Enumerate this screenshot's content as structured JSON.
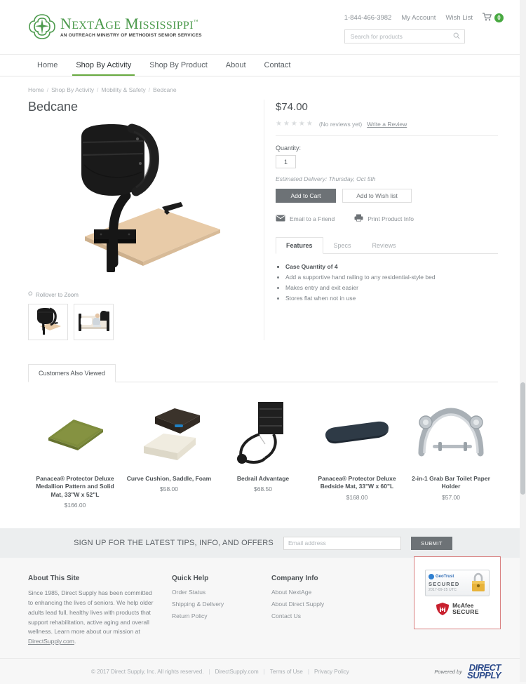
{
  "header": {
    "logo_title_parts": [
      "N",
      "EXT",
      "A",
      "GE",
      " M",
      "ISSISSIPPI"
    ],
    "logo_title": "NextAge Mississippi",
    "logo_tm": "™",
    "logo_subtitle": "AN OUTREACH MINISTRY OF METHODIST SENIOR SERVICES",
    "phone": "1-844-466-3982",
    "my_account": "My Account",
    "wish_list": "Wish List",
    "cart_count": "0",
    "search_placeholder": "Search for products",
    "search_value": "",
    "accent_green": "#4c9a4c",
    "cart_badge_green": "#49a942"
  },
  "nav": {
    "items": [
      {
        "label": "Home",
        "active": false
      },
      {
        "label": "Shop By Activity",
        "active": true
      },
      {
        "label": "Shop By Product",
        "active": false
      },
      {
        "label": "About",
        "active": false
      },
      {
        "label": "Contact",
        "active": false
      }
    ]
  },
  "breadcrumb": {
    "items": [
      "Home",
      "Shop By Activity",
      "Mobility & Safety",
      "Bedcane"
    ],
    "separator": "/"
  },
  "product": {
    "title": "Bedcane",
    "price": "$74.00",
    "stars": "★★★★★",
    "reviews_text": "(No reviews yet)",
    "write_review": "Write a Review",
    "quantity_label": "Quantity:",
    "quantity_value": "1",
    "estimated_delivery": "Estimated Delivery: Thursday, Oct 5th",
    "add_to_cart": "Add to Cart",
    "add_to_wish_list": "Add to Wish list",
    "email_friend": "Email to a Friend",
    "print_info": "Print Product Info",
    "rollover_zoom": "Rollover to Zoom",
    "tabs": [
      {
        "label": "Features",
        "active": true
      },
      {
        "label": "Specs",
        "active": false
      },
      {
        "label": "Reviews",
        "active": false
      }
    ],
    "features": [
      {
        "text": "Case Quantity of 4",
        "bold": true
      },
      {
        "text": "Add a supportive hand railing to any residential-style bed",
        "bold": false
      },
      {
        "text": "Makes entry and exit easier",
        "bold": false
      },
      {
        "text": "Stores flat when not in use",
        "bold": false
      }
    ]
  },
  "also_viewed": {
    "tab_label": "Customers Also Viewed",
    "items": [
      {
        "name": "Panacea® Protector Deluxe Medallion Pattern and Solid Mat, 33\"W x 52\"L",
        "price": "$166.00",
        "image": "olive-mat"
      },
      {
        "name": "Curve Cushion, Saddle, Foam",
        "price": "$58.00",
        "image": "cushion-stack"
      },
      {
        "name": "Bedrail Advantage",
        "price": "$68.50",
        "image": "bedrail"
      },
      {
        "name": "Panacea® Protector Deluxe Bedside Mat, 33\"W x 60\"L",
        "price": "$168.00",
        "image": "navy-mat"
      },
      {
        "name": "2-in-1 Grab Bar Toilet Paper Holder",
        "price": "$57.00",
        "image": "grab-bar"
      }
    ]
  },
  "newsletter": {
    "heading": "SIGN UP FOR THE LATEST TIPS, INFO, AND OFFERS",
    "placeholder": "Email address",
    "value": "",
    "submit_label": "SUBMIT"
  },
  "footer": {
    "about": {
      "title": "About This Site",
      "body_before": "Since 1985, Direct Supply has been committed to enhancing the lives of seniors. We help older adults lead full, healthy lives with products that support rehabilitation, active aging and overall wellness. Learn more about our mission at ",
      "link": "DirectSupply.com",
      "body_after": "."
    },
    "quick_help": {
      "title": "Quick Help",
      "links": [
        "Order Status",
        "Shipping & Delivery",
        "Return Policy"
      ]
    },
    "company_info": {
      "title": "Company Info",
      "links": [
        "About NextAge",
        "About Direct Supply",
        "Contact Us"
      ]
    },
    "seals": {
      "geotrust_brand": "GeoTrust",
      "geotrust_secured": "SECURED",
      "geotrust_date": "2017-09-25 UTC",
      "mcafee_line1": "McAfee",
      "mcafee_line2": "SECURE",
      "border_color": "#d98080"
    }
  },
  "copyright": {
    "text": "© 2017 Direct Supply, Inc. All rights reserved.",
    "links": [
      "DirectSupply.com",
      "Terms of Use",
      "Privacy Policy"
    ],
    "separator": "|",
    "powered_by": "Powered by",
    "ds_line1": "DIRECT",
    "ds_line2": "SUPPLY"
  }
}
